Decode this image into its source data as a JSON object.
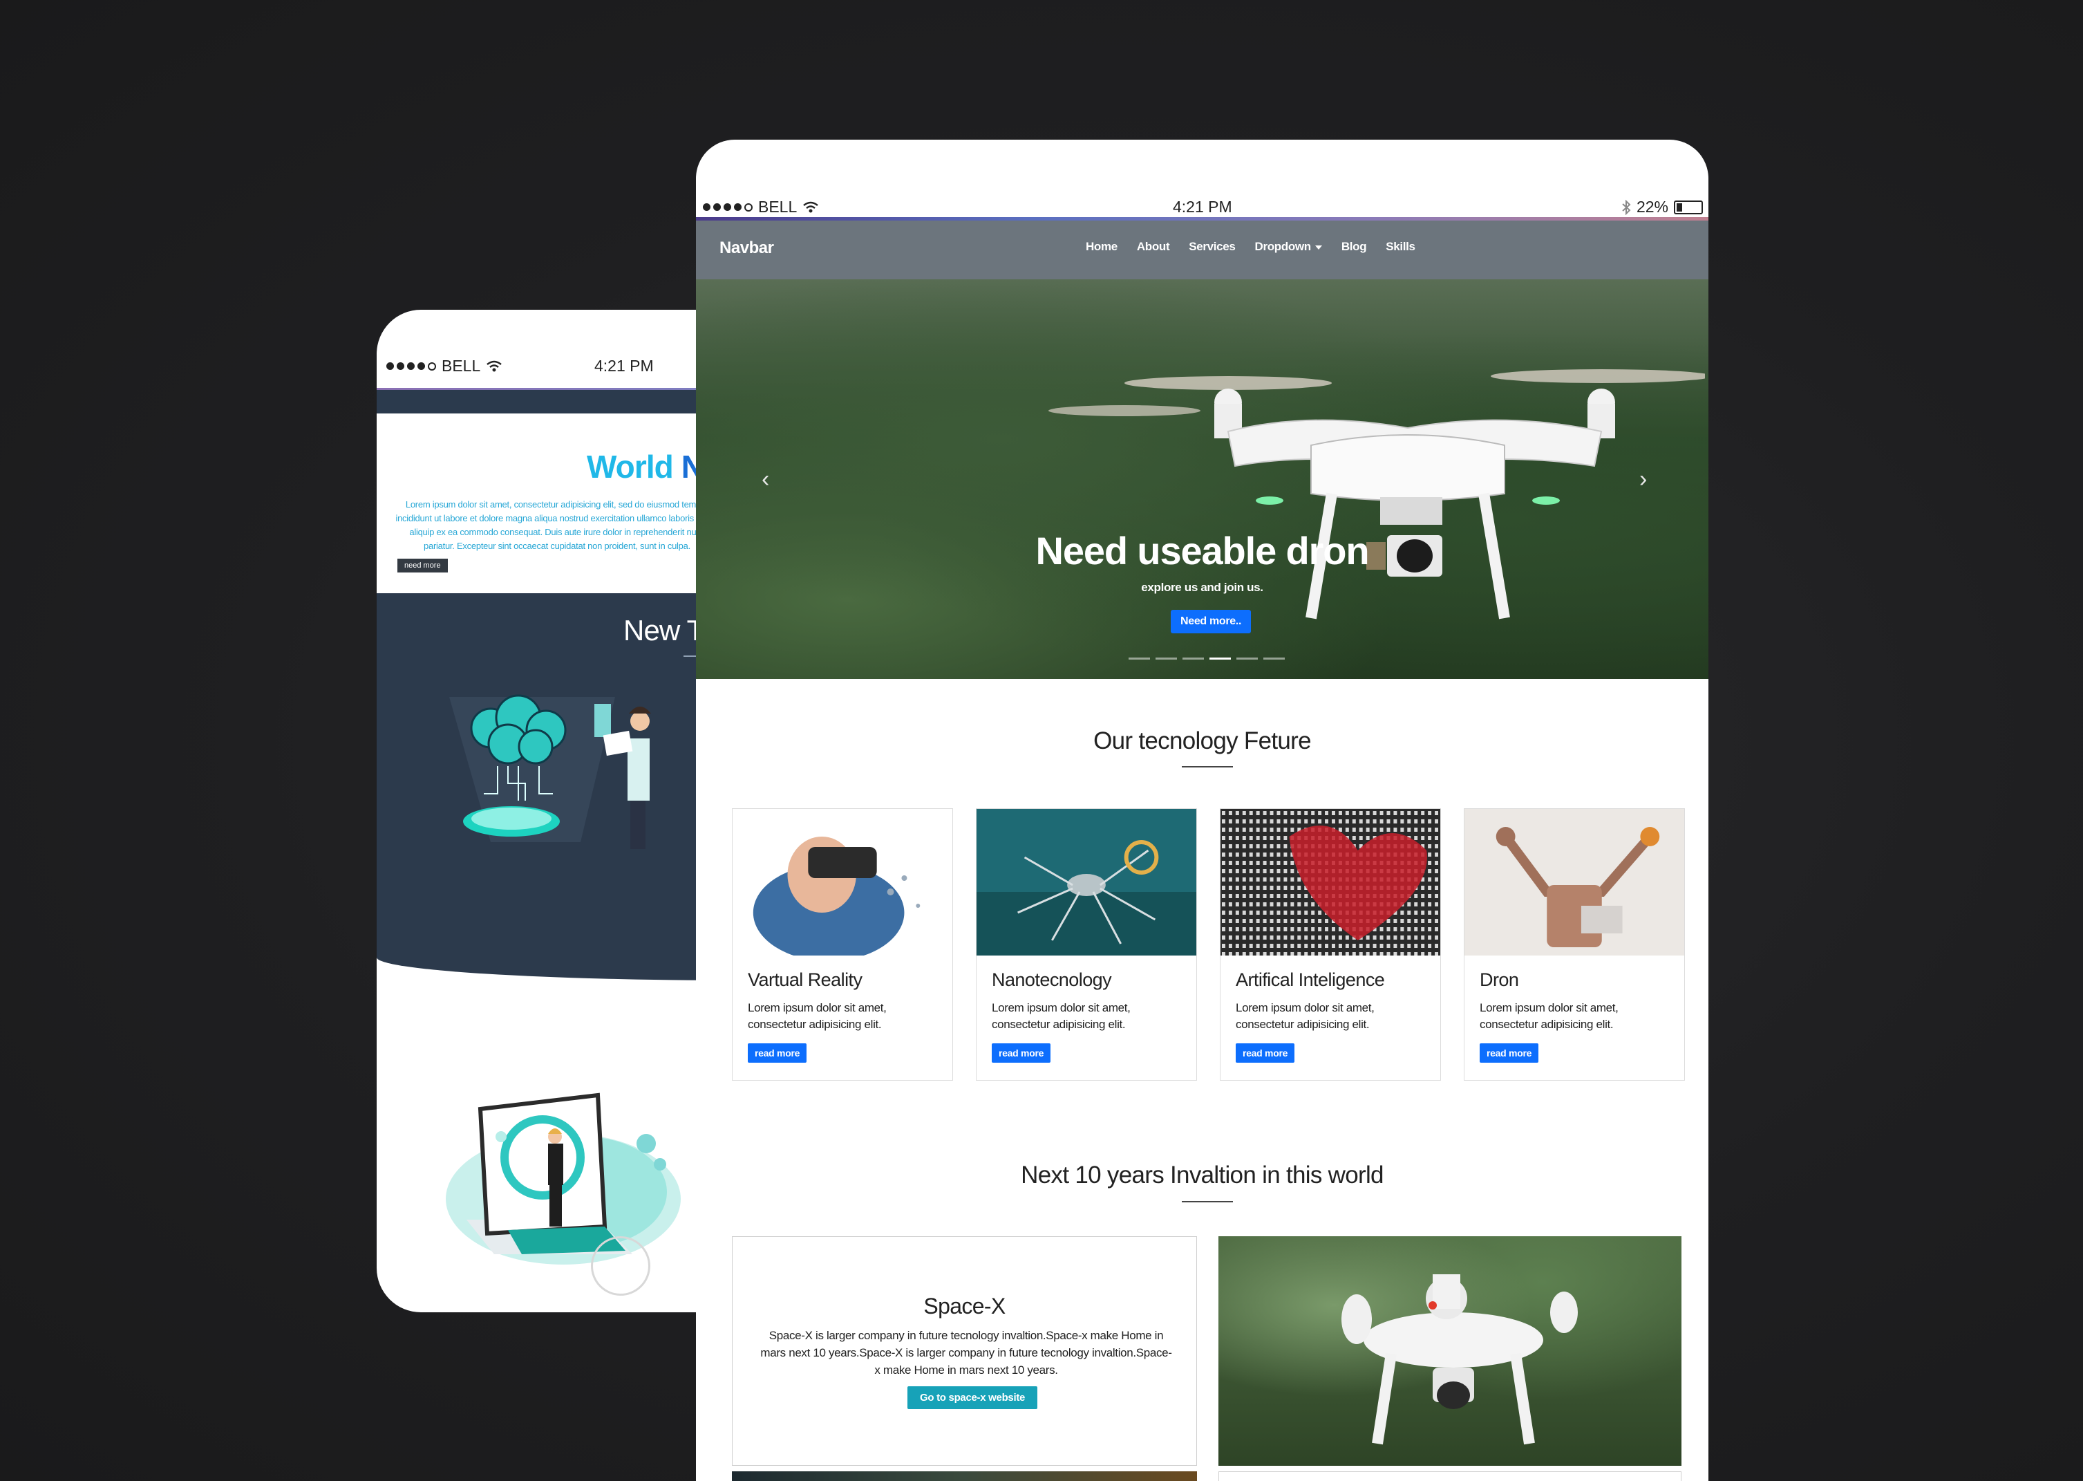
{
  "phone": {
    "status": {
      "carrier": "BELL",
      "time": "4:21 PM"
    },
    "hero": {
      "title_part1": "World",
      "title_part2": "Need",
      "text": "Lorem ipsum dolor sit amet, consectetur adipisicing elit, sed do eiusmod tempor incididunt ut labore et dolore magna aliqua nostrud exercitation ullamco laboris nisi ut aliquip ex ea commodo consequat. Duis aute irure dolor in reprehenderit nulla pariatur. Excepteur sint occaecat cupidatat non proident, sunt in culpa.",
      "button": "need more"
    },
    "section2_title": "New Te"
  },
  "tablet": {
    "status": {
      "carrier": "BELL",
      "time": "4:21 PM",
      "battery": "22%"
    },
    "navbar": {
      "brand": "Navbar",
      "links": [
        "Home",
        "About",
        "Services",
        "Dropdown",
        "Blog",
        "Skills"
      ]
    },
    "hero": {
      "title": "Need useable dron",
      "subtitle": "explore us and join us.",
      "button": "Need more..",
      "indicator_count": 6,
      "active_indicator": 4
    },
    "features": {
      "title": "Our tecnology Feture",
      "cards": [
        {
          "title": "Vartual Reality",
          "text": "Lorem ipsum dolor sit amet, consectetur adipisicing elit.",
          "button": "read more"
        },
        {
          "title": "Nanotecnology",
          "text": "Lorem ipsum dolor sit amet, consectetur adipisicing elit.",
          "button": "read more"
        },
        {
          "title": "Artifical Inteligence",
          "text": "Lorem ipsum dolor sit amet, consectetur adipisicing elit.",
          "button": "read more"
        },
        {
          "title": "Dron",
          "text": "Lorem ipsum dolor sit amet, consectetur adipisicing elit.",
          "button": "read more"
        }
      ]
    },
    "future": {
      "title": "Next 10 years Invaltion in this world",
      "spacex": {
        "title": "Space-X",
        "text": "Space-X is larger company in future tecnology invaltion.Space-x make Home in mars next 10 years.Space-X is larger company in future tecnology invaltion.Space-x make Home in mars next 10 years.",
        "button": "Go to space-x website"
      }
    }
  },
  "colors": {
    "background": "#1f1f21",
    "navbar": "#6c757d",
    "primary": "#0d6efd",
    "info": "#17a2b8",
    "phone_dark": "#2c3a4c",
    "phone_accent": "#20b8e8"
  }
}
